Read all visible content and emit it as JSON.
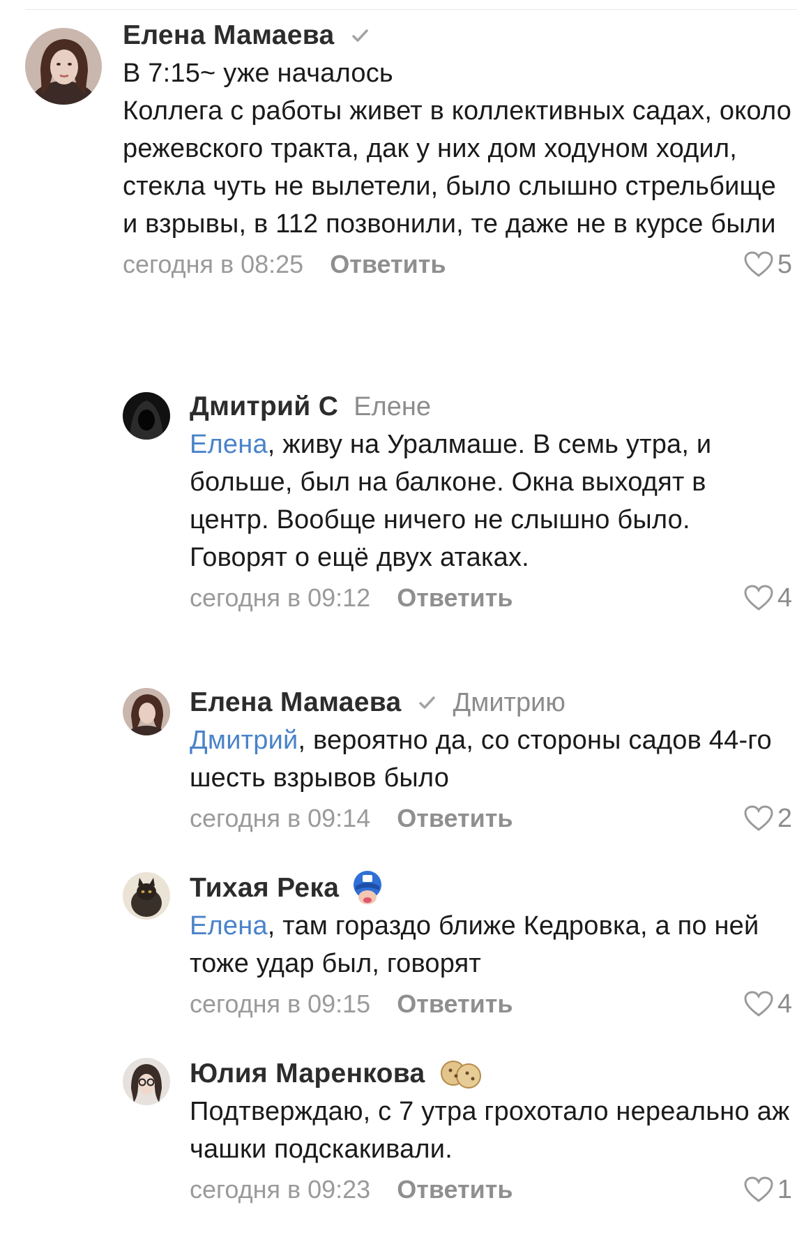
{
  "comments": [
    {
      "author": "Елена Мамаева",
      "verified": true,
      "reply_to": "",
      "mention": "",
      "text": "В 7:15~ уже началось\nКоллега с работы живет в коллективных садах, около режевского тракта, дак у них дом ходуном ходил, стекла чуть не вылетели, было слышно стрельбище и взрывы, в 112 позвонили, те даже не в курсе были",
      "date": "сегодня в 08:25",
      "reply_label": "Ответить",
      "likes": "5"
    },
    {
      "author": "Дмитрий С",
      "verified": false,
      "reply_to": "Елене",
      "mention": "Елена",
      "text": ", живу на Уралмаше. В семь утра, и больше, был на балконе. Окна выходят в центр. Вообще ничего не слышно было.\nГоворят о ещё двух атаках.",
      "date": "сегодня в 09:12",
      "reply_label": "Ответить",
      "likes": "4"
    },
    {
      "author": "Елена Мамаева",
      "verified": true,
      "reply_to": "Дмитрию",
      "mention": "Дмитрий",
      "text": ", вероятно да, со стороны садов 44-го шесть взрывов было",
      "date": "сегодня в 09:14",
      "reply_label": "Ответить",
      "likes": "2"
    },
    {
      "author": "Тихая Река",
      "verified": false,
      "badge": "hero-mask-sticker-icon",
      "reply_to": "",
      "mention": "Елена",
      "text": ", там гораздо ближе Кедровка, а по ней тоже удар был, говорят",
      "date": "сегодня в 09:15",
      "reply_label": "Ответить",
      "likes": "4"
    },
    {
      "author": "Юлия Маренкова",
      "verified": false,
      "badge": "cookies-sticker-icon",
      "reply_to": "",
      "mention": "",
      "text": "Подтверждаю, с 7 утра грохотало нереально аж чашки подскакивали.",
      "date": "сегодня в 09:23",
      "reply_label": "Ответить",
      "likes": "1"
    }
  ],
  "colors": {
    "mention": "#4a83c9",
    "muted": "#9a9a9a",
    "author": "#2c2c2c"
  }
}
